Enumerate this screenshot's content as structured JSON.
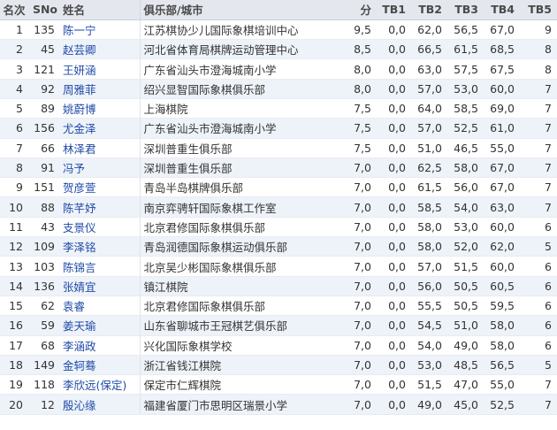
{
  "table": {
    "headers": {
      "rank": "名次",
      "sno": "SNo",
      "name": "姓名",
      "club": "俱乐部/城市",
      "points": "分",
      "tb1": "TB1",
      "tb2": "TB2",
      "tb3": "TB3",
      "tb4": "TB4",
      "tb5": "TB5"
    },
    "rows": [
      {
        "rank": "1",
        "sno": "135",
        "name": "陈一宁",
        "club": "江苏棋协少儿国际象棋培训中心",
        "points": "9,5",
        "tb1": "0,0",
        "tb2": "62,0",
        "tb3": "56,5",
        "tb4": "67,0",
        "tb5": "9"
      },
      {
        "rank": "2",
        "sno": "45",
        "name": "赵芸卿",
        "club": "河北省体育局棋牌运动管理中心",
        "points": "8,5",
        "tb1": "0,0",
        "tb2": "66,5",
        "tb3": "61,5",
        "tb4": "68,5",
        "tb5": "8"
      },
      {
        "rank": "3",
        "sno": "121",
        "name": "王妍涵",
        "club": "广东省汕头市澄海城南小学",
        "points": "8,0",
        "tb1": "0,0",
        "tb2": "63,0",
        "tb3": "57,5",
        "tb4": "67,5",
        "tb5": "8"
      },
      {
        "rank": "4",
        "sno": "92",
        "name": "周雅菲",
        "club": "绍兴显智国际象棋俱乐部",
        "points": "8,0",
        "tb1": "0,0",
        "tb2": "57,0",
        "tb3": "53,0",
        "tb4": "60,0",
        "tb5": "7"
      },
      {
        "rank": "5",
        "sno": "89",
        "name": "姚蔚博",
        "club": "上海棋院",
        "points": "7,5",
        "tb1": "0,0",
        "tb2": "64,0",
        "tb3": "58,5",
        "tb4": "69,0",
        "tb5": "7"
      },
      {
        "rank": "6",
        "sno": "156",
        "name": "尤金泽",
        "club": "广东省汕头市澄海城南小学",
        "points": "7,5",
        "tb1": "0,0",
        "tb2": "57,0",
        "tb3": "52,5",
        "tb4": "61,0",
        "tb5": "7"
      },
      {
        "rank": "7",
        "sno": "66",
        "name": "林泽君",
        "club": "深圳普重生俱乐部",
        "points": "7,5",
        "tb1": "0,0",
        "tb2": "51,0",
        "tb3": "46,5",
        "tb4": "55,0",
        "tb5": "7"
      },
      {
        "rank": "8",
        "sno": "91",
        "name": "冯予",
        "club": "深圳普重生俱乐部",
        "points": "7,0",
        "tb1": "0,0",
        "tb2": "62,5",
        "tb3": "58,0",
        "tb4": "67,0",
        "tb5": "7"
      },
      {
        "rank": "9",
        "sno": "151",
        "name": "贺彦萱",
        "club": "青岛半岛棋牌俱乐部",
        "points": "7,0",
        "tb1": "0,0",
        "tb2": "61,5",
        "tb3": "56,0",
        "tb4": "67,0",
        "tb5": "7"
      },
      {
        "rank": "10",
        "sno": "88",
        "name": "陈芊妤",
        "club": "南京弈骋轩国际象棋工作室",
        "points": "7,0",
        "tb1": "0,0",
        "tb2": "58,5",
        "tb3": "54,0",
        "tb4": "63,0",
        "tb5": "7"
      },
      {
        "rank": "11",
        "sno": "43",
        "name": "支景仪",
        "club": "北京君修国际象棋俱乐部",
        "points": "7,0",
        "tb1": "0,0",
        "tb2": "58,0",
        "tb3": "53,0",
        "tb4": "60,0",
        "tb5": "6"
      },
      {
        "rank": "12",
        "sno": "109",
        "name": "李泽铭",
        "club": "青岛润德国际象棋运动俱乐部",
        "points": "7,0",
        "tb1": "0,0",
        "tb2": "58,0",
        "tb3": "52,0",
        "tb4": "62,0",
        "tb5": "5"
      },
      {
        "rank": "13",
        "sno": "103",
        "name": "陈锦言",
        "club": "北京吴少彬国际象棋俱乐部",
        "points": "7,0",
        "tb1": "0,0",
        "tb2": "57,0",
        "tb3": "51,5",
        "tb4": "60,0",
        "tb5": "6"
      },
      {
        "rank": "14",
        "sno": "136",
        "name": "张婧宜",
        "club": "镇江棋院",
        "points": "7,0",
        "tb1": "0,0",
        "tb2": "56,0",
        "tb3": "50,5",
        "tb4": "60,5",
        "tb5": "6"
      },
      {
        "rank": "15",
        "sno": "62",
        "name": "袁睿",
        "club": "北京君修国际象棋俱乐部",
        "points": "7,0",
        "tb1": "0,0",
        "tb2": "55,5",
        "tb3": "50,5",
        "tb4": "59,5",
        "tb5": "6"
      },
      {
        "rank": "16",
        "sno": "59",
        "name": "姜天瑜",
        "club": "山东省聊城市王冠棋艺俱乐部",
        "points": "7,0",
        "tb1": "0,0",
        "tb2": "54,5",
        "tb3": "51,0",
        "tb4": "58,0",
        "tb5": "6"
      },
      {
        "rank": "17",
        "sno": "68",
        "name": "李涵政",
        "club": "兴化国际象棋学校",
        "points": "7,0",
        "tb1": "0,0",
        "tb2": "54,0",
        "tb3": "49,0",
        "tb4": "58,0",
        "tb5": "6"
      },
      {
        "rank": "18",
        "sno": "149",
        "name": "金轲蓦",
        "club": "浙江省钱江棋院",
        "points": "7,0",
        "tb1": "0,0",
        "tb2": "53,0",
        "tb3": "48,5",
        "tb4": "56,5",
        "tb5": "5"
      },
      {
        "rank": "19",
        "sno": "118",
        "name": "李欣远(保定)",
        "club": "保定市仁辉棋院",
        "points": "7,0",
        "tb1": "0,0",
        "tb2": "51,5",
        "tb3": "47,0",
        "tb4": "55,0",
        "tb5": "7"
      },
      {
        "rank": "20",
        "sno": "12",
        "name": "殷沁缘",
        "club": "福建省厦门市思明区瑞景小学",
        "points": "7,0",
        "tb1": "0,0",
        "tb2": "49,0",
        "tb3": "45,0",
        "tb4": "52,5",
        "tb5": "7"
      }
    ]
  }
}
